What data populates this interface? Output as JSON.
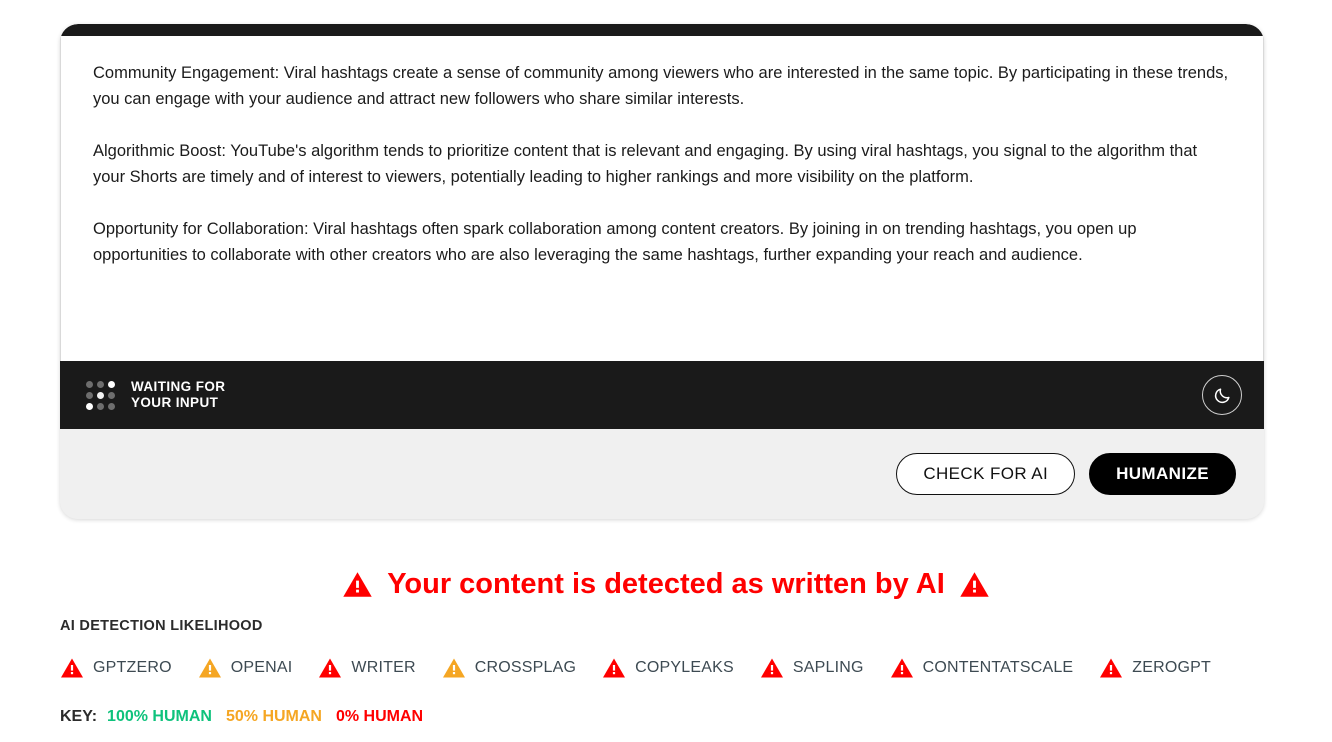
{
  "editor": {
    "paragraphs": [
      "Community Engagement: Viral hashtags create a sense of community among viewers who are interested in the same topic. By participating in these trends, you can engage with your audience and attract new followers who share similar interests.",
      "Algorithmic Boost: YouTube's algorithm tends to prioritize content that is relevant and engaging. By using viral hashtags, you signal to the algorithm that your Shorts are timely and of interest to viewers, potentially leading to higher rankings and more visibility on the platform.",
      "Opportunity for Collaboration: Viral hashtags often spark collaboration among content creators. By joining in on trending hashtags, you open up opportunities to collaborate with other creators who are also leveraging the same hashtags, further expanding your reach and audience."
    ],
    "status": {
      "line1": "WAITING FOR",
      "line2": "YOUR INPUT",
      "loader_icon": "nine-dot-grid-icon",
      "theme_toggle_icon": "moon-icon"
    },
    "actions": {
      "check_label": "CHECK FOR AI",
      "humanize_label": "HUMANIZE"
    }
  },
  "verdict": {
    "text": "Your content is detected as written by AI",
    "icon": "warning-triangle-icon",
    "color": "#ff0000"
  },
  "detection": {
    "label": "AI DETECTION LIKELIHOOD",
    "detectors": [
      {
        "name": "GPTZERO",
        "status": "ai",
        "color": "#ff0000"
      },
      {
        "name": "OPENAI",
        "status": "mixed",
        "color": "#f5a623"
      },
      {
        "name": "WRITER",
        "status": "ai",
        "color": "#ff0000"
      },
      {
        "name": "CROSSPLAG",
        "status": "mixed",
        "color": "#f5a623"
      },
      {
        "name": "COPYLEAKS",
        "status": "ai",
        "color": "#ff0000"
      },
      {
        "name": "SAPLING",
        "status": "ai",
        "color": "#ff0000"
      },
      {
        "name": "CONTENTATSCALE",
        "status": "ai",
        "color": "#ff0000"
      },
      {
        "name": "ZEROGPT",
        "status": "ai",
        "color": "#ff0000"
      }
    ]
  },
  "key": {
    "label": "KEY:",
    "items": [
      {
        "text": "100% HUMAN",
        "color": "#0ec27c"
      },
      {
        "text": "50% HUMAN",
        "color": "#f5a623"
      },
      {
        "text": "0% HUMAN",
        "color": "#ff0000"
      }
    ]
  }
}
